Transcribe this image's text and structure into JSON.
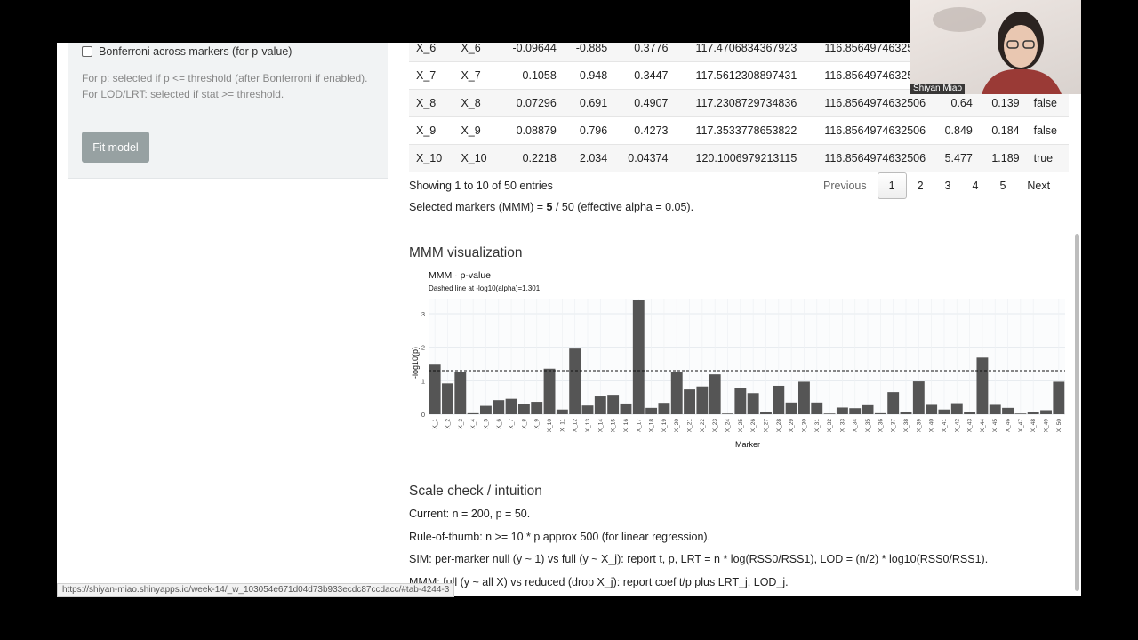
{
  "sidebar": {
    "bonferroni_label": "Bonferroni across markers (for p-value)",
    "help_line1": "For p: selected if p <= threshold (after Bonferroni if enabled).",
    "help_line2": "For LOD/LRT: selected if stat >= threshold.",
    "fit_button": "Fit model"
  },
  "table": {
    "rows": [
      {
        "marker": "X_6",
        "name": "X_6",
        "coef": "-0.09644",
        "t": "-0.885",
        "p": "0.3776",
        "rss0": "117.4706834367923",
        "rss1": "116.8564974632506",
        "lrt": "",
        "lod": "",
        "sel": ""
      },
      {
        "marker": "X_7",
        "name": "X_7",
        "coef": "-0.1058",
        "t": "-0.948",
        "p": "0.3447",
        "rss0": "117.5612308897431",
        "rss1": "116.8564974632506",
        "lrt": "",
        "lod": "",
        "sel": ""
      },
      {
        "marker": "X_8",
        "name": "X_8",
        "coef": "0.07296",
        "t": "0.691",
        "p": "0.4907",
        "rss0": "117.2308729734836",
        "rss1": "116.8564974632506",
        "lrt": "0.64",
        "lod": "0.139",
        "sel": "false"
      },
      {
        "marker": "X_9",
        "name": "X_9",
        "coef": "0.08879",
        "t": "0.796",
        "p": "0.4273",
        "rss0": "117.3533778653822",
        "rss1": "116.8564974632506",
        "lrt": "0.849",
        "lod": "0.184",
        "sel": "false"
      },
      {
        "marker": "X_10",
        "name": "X_10",
        "coef": "0.2218",
        "t": "2.034",
        "p": "0.04374",
        "rss0": "120.1006979213115",
        "rss1": "116.8564974632506",
        "lrt": "5.477",
        "lod": "1.189",
        "sel": "true"
      }
    ],
    "info": "Showing 1 to 10 of 50 entries",
    "pager": {
      "previous": "Previous",
      "pages": [
        "1",
        "2",
        "3",
        "4",
        "5"
      ],
      "next": "Next",
      "current": "1"
    }
  },
  "selected": {
    "prefix": "Selected markers (MMM) = ",
    "count": "5",
    "suffix": " / 50 (effective alpha = 0.05)."
  },
  "viz_title": "MMM visualization",
  "chart_data": {
    "type": "bar",
    "title": "MMM · p-value",
    "subtitle": "Dashed line at -log10(alpha)=1.301",
    "xlabel": "Marker",
    "ylabel": "-log10(p)",
    "ylim": [
      0,
      3.45
    ],
    "yticks": [
      0,
      1,
      2,
      3
    ],
    "threshold": 1.301,
    "categories": [
      "X_1",
      "X_2",
      "X_3",
      "X_4",
      "X_5",
      "X_6",
      "X_7",
      "X_8",
      "X_9",
      "X_10",
      "X_11",
      "X_12",
      "X_13",
      "X_14",
      "X_15",
      "X_16",
      "X_17",
      "X_18",
      "X_19",
      "X_20",
      "X_21",
      "X_22",
      "X_23",
      "X_24",
      "X_25",
      "X_26",
      "X_27",
      "X_28",
      "X_29",
      "X_30",
      "X_31",
      "X_32",
      "X_33",
      "X_34",
      "X_35",
      "X_36",
      "X_37",
      "X_38",
      "X_39",
      "X_40",
      "X_41",
      "X_42",
      "X_43",
      "X_44",
      "X_45",
      "X_46",
      "X_47",
      "X_48",
      "X_49",
      "X_50"
    ],
    "values": [
      1.48,
      0.92,
      1.25,
      0.03,
      0.25,
      0.42,
      0.46,
      0.31,
      0.37,
      1.36,
      0.14,
      1.96,
      0.26,
      0.53,
      0.58,
      0.32,
      3.4,
      0.19,
      0.34,
      1.27,
      0.74,
      0.83,
      1.19,
      0.02,
      0.78,
      0.63,
      0.06,
      0.85,
      0.35,
      0.97,
      0.35,
      0.02,
      0.2,
      0.18,
      0.27,
      0.03,
      0.66,
      0.07,
      0.98,
      0.28,
      0.14,
      0.33,
      0.06,
      1.69,
      0.28,
      0.19,
      0.02,
      0.07,
      0.12,
      0.97
    ],
    "grid": true
  },
  "scale": {
    "title": "Scale check / intuition",
    "current": "Current: n = 200, p = 50.",
    "rule": "Rule-of-thumb: n >= 10 * p approx 500 (for linear regression).",
    "sim": "SIM: per-marker null (y ~ 1) vs full (y ~ X_j): report t, p, LRT = n * log(RSS0/RSS1), LOD = (n/2) * log10(RSS0/RSS1).",
    "mmm": "MMM: full (y ~ all X) vs reduced (drop X_j): report coef t/p plus LRT_j, LOD_j."
  },
  "status_url": "https://shiyan-miao.shinyapps.io/week-14/_w_103054e671d04d73b933ecdc87ccdacc/#tab-4244-3",
  "webcam_name": "Shiyan Miao"
}
